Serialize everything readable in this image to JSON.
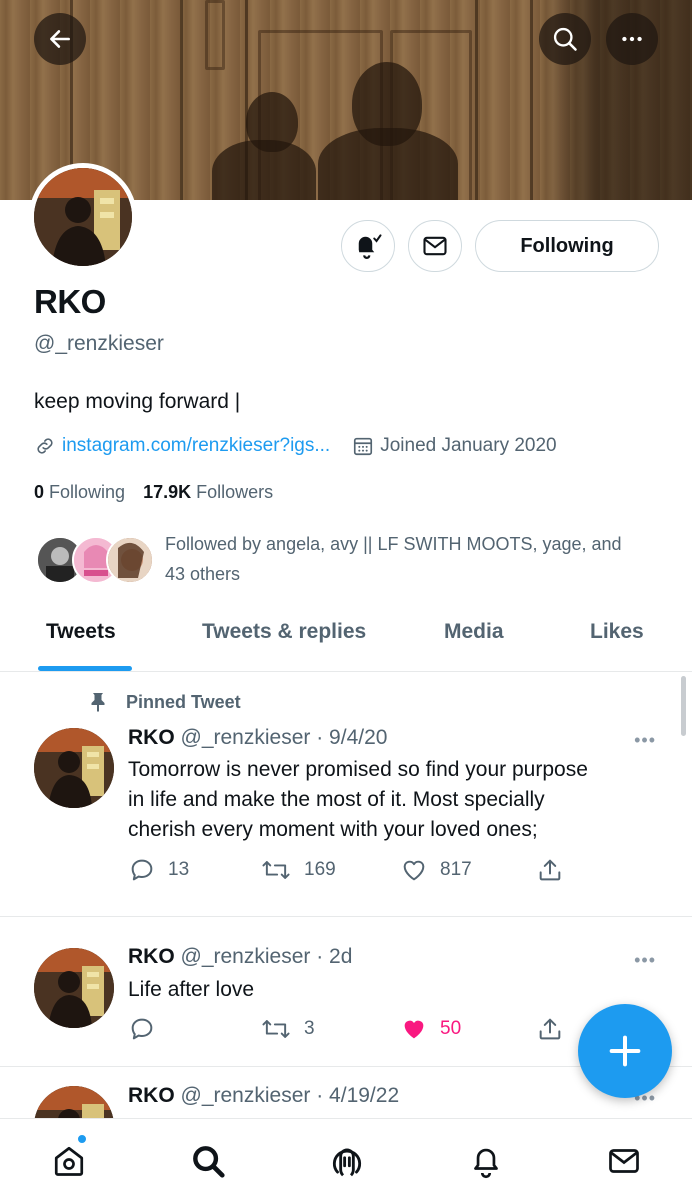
{
  "header": {
    "back_icon": "arrow-left-icon",
    "search_icon": "search-icon",
    "more_icon": "more-horizontal-icon"
  },
  "profile": {
    "name": "RKO",
    "handle": "@_renzkieser",
    "bio": "keep moving forward |",
    "link": "instagram.com/renzkieser?igs...",
    "joined": "Joined January 2020",
    "following_count": "0",
    "following_label": "Following",
    "followers_count": "17.9K",
    "followers_label": "Followers",
    "followed_by_line1": "Followed by angela, avy || LF SWITH MOOTS, yage, and",
    "followed_by_line2": "43 others"
  },
  "actions": {
    "notify_icon": "bell-check-icon",
    "message_icon": "mail-icon",
    "follow_button": "Following"
  },
  "tabs": [
    {
      "label": "Tweets",
      "active": true
    },
    {
      "label": "Tweets & replies",
      "active": false
    },
    {
      "label": "Media",
      "active": false
    },
    {
      "label": "Likes",
      "active": false
    }
  ],
  "pinned_label": "Pinned Tweet",
  "tweets": [
    {
      "name": "RKO",
      "handle": "@_renzkieser",
      "time": "· 9/4/20",
      "lines": [
        "Tomorrow is never promised so find your purpose",
        "in life and make the most of it. Most specially",
        "cherish every moment with your loved ones;"
      ],
      "replies": "13",
      "retweets": "169",
      "likes": "817",
      "liked": false
    },
    {
      "name": "RKO",
      "handle": "@_renzkieser",
      "time": "· 2d",
      "lines": [
        "Life after love"
      ],
      "replies": "",
      "retweets": "3",
      "likes": "50",
      "liked": true
    },
    {
      "name": "RKO",
      "handle": "@_renzkieser",
      "time": "· 4/19/22",
      "lines": [],
      "replies": "",
      "retweets": "",
      "likes": "",
      "liked": false
    }
  ],
  "more_dots": "•••",
  "bottom_nav": [
    "home-icon",
    "explore-search-icon",
    "spaces-icon",
    "notifications-icon",
    "messages-icon"
  ],
  "colors": {
    "accent": "#1d9bf0",
    "like": "#f91880",
    "text_primary": "#0f1419",
    "text_secondary": "#536471"
  }
}
